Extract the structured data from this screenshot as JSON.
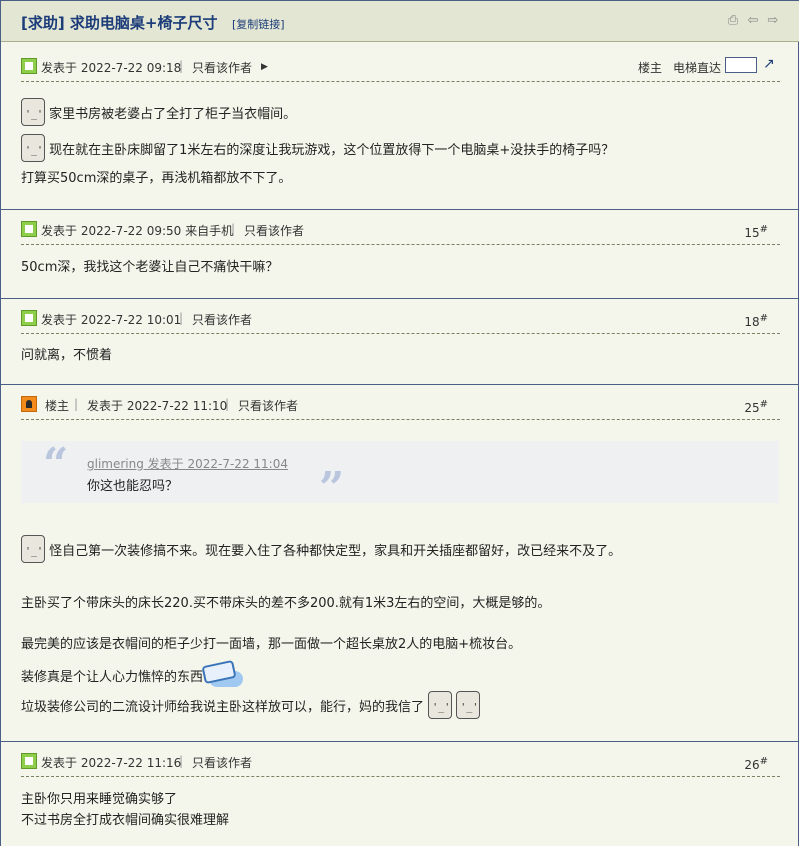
{
  "thread": {
    "title": "[求助] 求助电脑桌+椅子尺寸",
    "copy_link": "[复制链接]",
    "icons": [
      "print-icon",
      "prev-thread-icon",
      "next-thread-icon"
    ]
  },
  "posts": [
    {
      "meta": "发表于 2022-7-22 09:18",
      "only_author": "只看该作者",
      "landlord": "楼主",
      "jump_label": "电梯直达",
      "lines": [
        "家里书房被老婆占了全打了柜子当衣帽间。",
        "现在就在主卧床脚留了1米左右的深度让我玩游戏，这个位置放得下一个电脑桌+没扶手的椅子吗？",
        "打算买50cm深的桌子，再浅机箱都放不下了。"
      ]
    },
    {
      "meta": "发表于 2022-7-22 09:50 来自手机",
      "only_author": "只看该作者",
      "floor": "15",
      "lines": [
        "50cm深，我找这个老婆让自己不痛快干嘛？"
      ]
    },
    {
      "meta": "发表于 2022-7-22 10:01",
      "only_author": "只看该作者",
      "floor": "18",
      "lines": [
        "问就离，不惯着"
      ]
    },
    {
      "author_tag": "楼主",
      "meta": "发表于 2022-7-22 11:10",
      "only_author": "只看该作者",
      "floor": "25",
      "quote_author": "glimering 发表于 2022-7-22 11:04",
      "quote_text": "你这也能忍吗？",
      "lines": [
        "怪自己第一次装修搞不来。现在要入住了各种都快定型，家具和开关插座都留好，改已经来不及了。",
        "主卧买了个带床头的床长220.买不带床头的差不多200.就有1米3左右的空间，大概是够的。",
        "最完美的应该是衣帽间的柜子少打一面墙，那一面做一个超长桌放2人的电脑+梳妆台。",
        "装修真是个让人心力憔悴的东西",
        "垃圾装修公司的二流设计师给我说主卧这样放可以，能行，妈的我信了"
      ]
    },
    {
      "meta": "发表于 2022-7-22 11:16",
      "only_author": "只看该作者",
      "floor": "26",
      "lines": [
        "主卧你只用来睡觉确实够了",
        "不过书房全打成衣帽间确实很难理解"
      ]
    }
  ],
  "floor_mark": "#"
}
